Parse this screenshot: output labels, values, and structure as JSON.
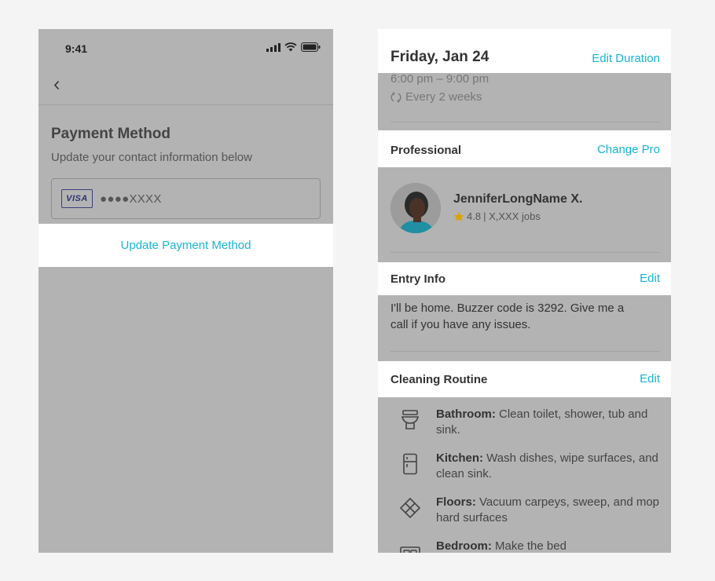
{
  "left": {
    "status": {
      "time": "9:41"
    },
    "title": "Payment Method",
    "subtitle": "Update your contact information below",
    "card": {
      "brand": "VISA",
      "number": "●●●●XXXX"
    },
    "update_button": "Update Payment Method"
  },
  "right": {
    "date_header": {
      "title": "Friday, Jan 24",
      "action": "Edit Duration"
    },
    "schedule": {
      "time_range": "6:00 pm – 9:00 pm",
      "recurrence": "Every 2 weeks"
    },
    "professional": {
      "title": "Professional",
      "action": "Change Pro",
      "name": "JenniferLongName X.",
      "rating": "4.8",
      "jobs": "| X,XXX jobs"
    },
    "entry_info": {
      "title": "Entry Info",
      "action": "Edit",
      "text": "I'll be home. Buzzer code is 3292. Give me a call if you have any issues."
    },
    "cleaning_routine": {
      "title": "Cleaning Routine",
      "action": "Edit",
      "items": [
        {
          "label": "Bathroom:",
          "text": " Clean toilet, shower, tub and sink.",
          "icon": "toilet-icon"
        },
        {
          "label": "Kitchen:",
          "text": " Wash dishes, wipe surfaces, and clean sink.",
          "icon": "fridge-icon"
        },
        {
          "label": "Floors:",
          "text": " Vacuum carpeys, sweep, and mop hard surfaces",
          "icon": "floor-tile-icon"
        },
        {
          "label": "Bedroom:",
          "text": " Make the bed",
          "icon": "bed-icon"
        }
      ]
    }
  },
  "colors": {
    "accent": "#15b4d6",
    "overlay": "#b3b3b3",
    "star": "#e0a800"
  }
}
